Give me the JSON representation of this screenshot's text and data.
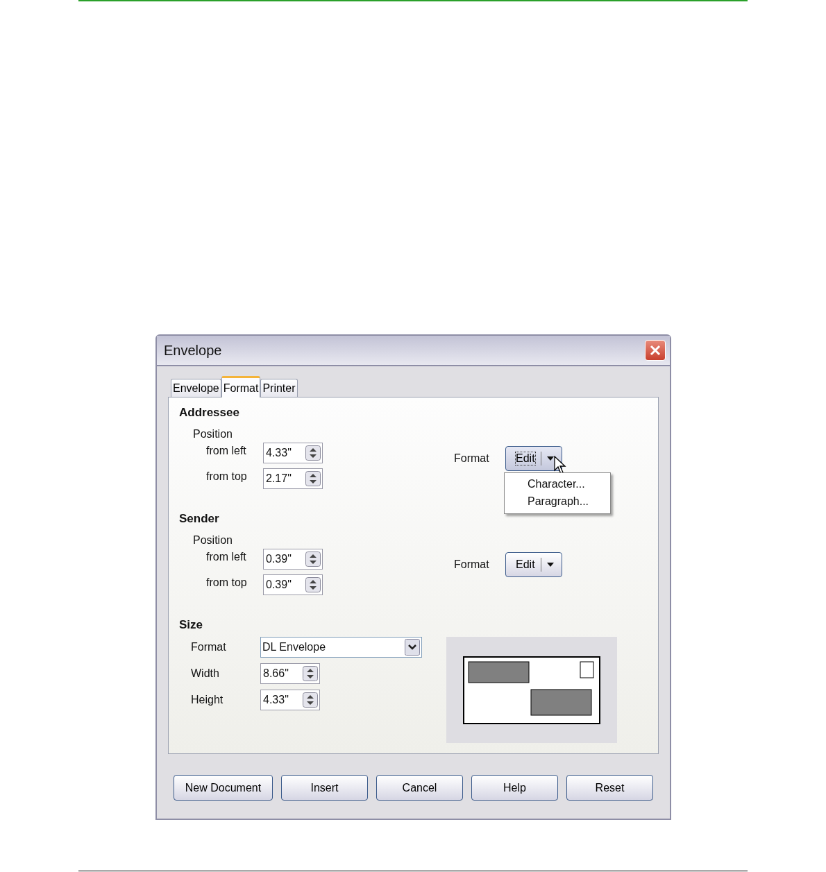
{
  "window": {
    "title": "Envelope"
  },
  "tabs": [
    {
      "label": "Envelope",
      "selected": false
    },
    {
      "label": "Format",
      "selected": true
    },
    {
      "label": "Printer",
      "selected": false
    }
  ],
  "sections": [
    {
      "title": "Addressee",
      "position_label": "Position",
      "fields": [
        {
          "label": "from left",
          "value": "4.33\""
        },
        {
          "label": "from top",
          "value": "2.17\""
        }
      ],
      "format_label": "Format",
      "edit_button": {
        "label": "Edit",
        "expanded": true,
        "menu": [
          "Character...",
          "Paragraph..."
        ]
      }
    },
    {
      "title": "Sender",
      "position_label": "Position",
      "fields": [
        {
          "label": "from left",
          "value": "0.39\""
        },
        {
          "label": "from top",
          "value": "0.39\""
        }
      ],
      "format_label": "Format",
      "edit_button": {
        "label": "Edit",
        "expanded": false
      }
    }
  ],
  "size": {
    "title": "Size",
    "format_label": "Format",
    "format_value": "DL Envelope",
    "fields": [
      {
        "label": "Width",
        "value": "8.66\""
      },
      {
        "label": "Height",
        "value": "4.33\""
      }
    ]
  },
  "buttons": [
    "New Document",
    "Insert",
    "Cancel",
    "Help",
    "Reset"
  ]
}
